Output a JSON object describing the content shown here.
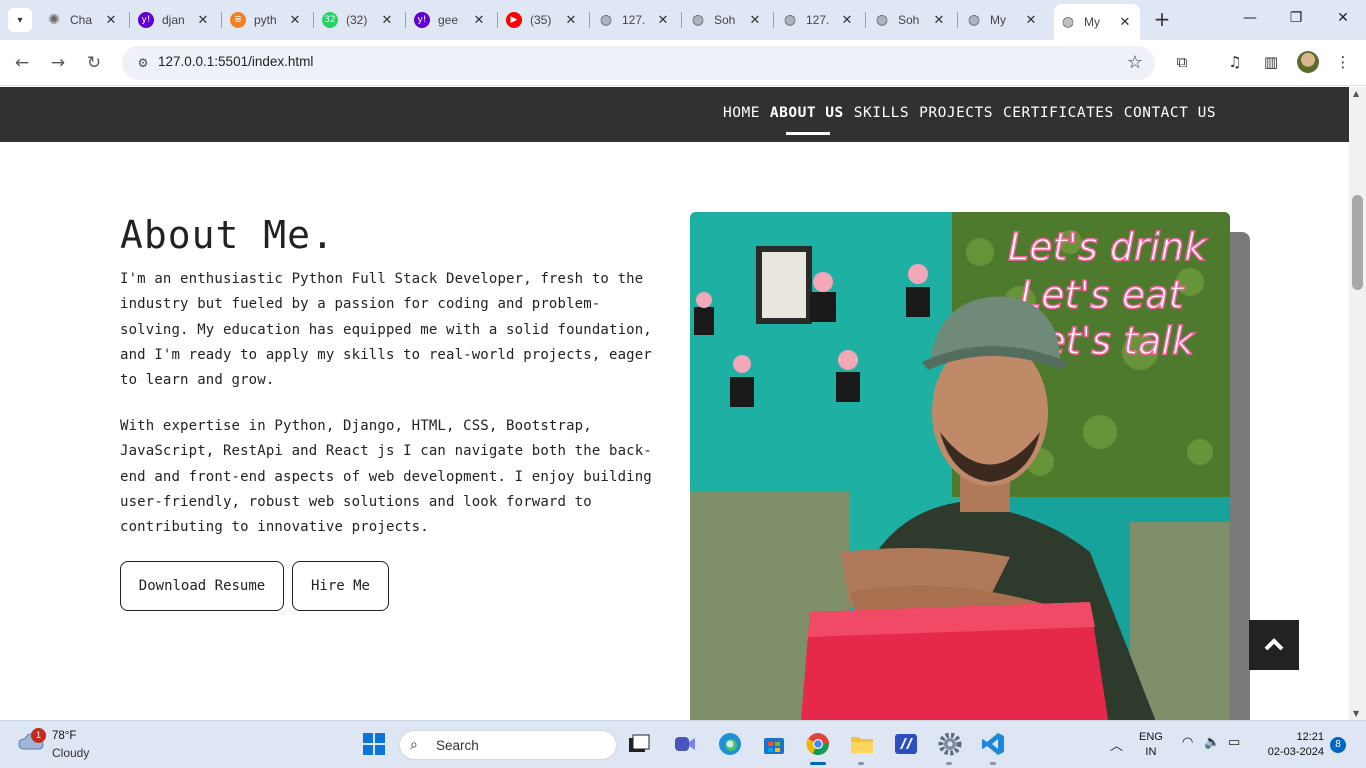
{
  "browser": {
    "tabs": [
      {
        "title": "Cha",
        "icon": "chatgpt-icon",
        "color": "#6b6b6b"
      },
      {
        "title": "djan",
        "icon": "yahoo-icon",
        "color": "#6001d2"
      },
      {
        "title": "pyth",
        "icon": "stackoverflow-icon",
        "color": "#f48024"
      },
      {
        "title": "(32)",
        "icon": "whatsapp-icon",
        "color": "#25d366",
        "badge": "32"
      },
      {
        "title": "gee",
        "icon": "yahoo-icon",
        "color": "#6001d2"
      },
      {
        "title": "(35)",
        "icon": "youtube-icon",
        "color": "#ff0000"
      },
      {
        "title": "127.",
        "icon": "globe-icon",
        "color": "#5f6368"
      },
      {
        "title": "Soh",
        "icon": "globe-icon",
        "color": "#5f6368"
      },
      {
        "title": "127.",
        "icon": "globe-icon",
        "color": "#5f6368"
      },
      {
        "title": "Soh",
        "icon": "globe-icon",
        "color": "#5f6368"
      },
      {
        "title": "My",
        "icon": "globe-icon",
        "color": "#5f6368"
      },
      {
        "title": "My",
        "icon": "globe-icon",
        "color": "#5f6368",
        "active": true
      }
    ],
    "url": "127.0.0.1:5501/index.html"
  },
  "site": {
    "nav": [
      {
        "label": "HOME",
        "active": false
      },
      {
        "label": "ABOUT US",
        "active": true
      },
      {
        "label": "SKILLS",
        "active": false
      },
      {
        "label": "PROJECTS",
        "active": false
      },
      {
        "label": "CERTIFICATES",
        "active": false
      },
      {
        "label": "CONTACT US",
        "active": false
      }
    ],
    "about": {
      "heading": "About Me.",
      "paragraph1": "I'm an enthusiastic Python Full Stack Developer, fresh to the industry but fueled by a passion for coding and problem-solving. My education has equipped me with a solid foundation, and I'm ready to apply my skills to real-world projects, eager to learn and grow.",
      "paragraph2": "With expertise in Python, Django, HTML, CSS, Bootstrap, JavaScript, RestApi and React js I can navigate both the back-end and front-end aspects of web development. I enjoy building user-friendly, robust web solutions and look forward to contributing to innovative projects.",
      "download_button": "Download Resume",
      "hire_button": "Hire Me"
    },
    "photo": {
      "neon_line1": "Let's drink",
      "neon_line2": "Let's eat",
      "neon_line3": "let's talk"
    },
    "accent": "#313131"
  },
  "taskbar": {
    "weather_badge": "1",
    "temperature": "78°F",
    "condition": "Cloudy",
    "search_placeholder": "Search",
    "language_line1": "ENG",
    "language_line2": "IN",
    "time": "12:21",
    "date": "02-03-2024",
    "notification_count": "8"
  }
}
